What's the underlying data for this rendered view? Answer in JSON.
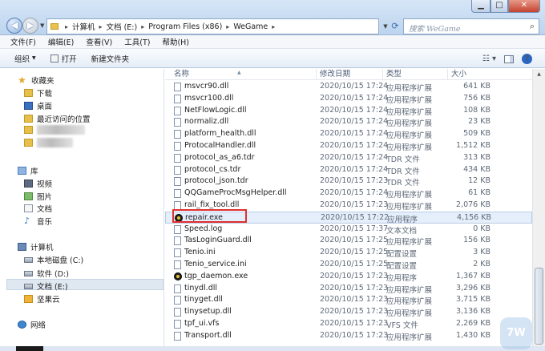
{
  "window": {
    "controls": {
      "minimize": "▁",
      "maximize": "□",
      "close": "✕"
    }
  },
  "nav_buttons": {
    "back": "◀",
    "forward": "▶"
  },
  "address": {
    "crumbs": [
      "计算机",
      "文档 (E:)",
      "Program Files (x86)",
      "WeGame"
    ],
    "separator": "▸"
  },
  "search": {
    "placeholder": "搜索 WeGame"
  },
  "menu": [
    "文件(F)",
    "编辑(E)",
    "查看(V)",
    "工具(T)",
    "帮助(H)"
  ],
  "toolbar": {
    "organize": "组织",
    "open": "打开",
    "new_folder": "新建文件夹"
  },
  "sidebar": {
    "favorites": "收藏夹",
    "downloads": "下载",
    "desktop": "桌面",
    "recent": "最近访问的位置",
    "libraries": "库",
    "videos": "视频",
    "pictures": "图片",
    "documents": "文档",
    "music": "音乐",
    "computer": "计算机",
    "drive_c": "本地磁盘 (C:)",
    "drive_d": "软件 (D:)",
    "drive_e": "文档 (E:)",
    "cloud": "坚果云",
    "network": "网络"
  },
  "columns": {
    "name": "名称",
    "date": "修改日期",
    "type": "类型",
    "size": "大小"
  },
  "files": [
    {
      "name": "msvcr90.dll",
      "date": "2020/10/15 17:24",
      "type": "应用程序扩展",
      "size": "641 KB",
      "icon": "dll"
    },
    {
      "name": "msvcr100.dll",
      "date": "2020/10/15 17:24",
      "type": "应用程序扩展",
      "size": "756 KB",
      "icon": "dll"
    },
    {
      "name": "NetFlowLogic.dll",
      "date": "2020/10/15 17:24",
      "type": "应用程序扩展",
      "size": "108 KB",
      "icon": "dll"
    },
    {
      "name": "normaliz.dll",
      "date": "2020/10/15 17:24",
      "type": "应用程序扩展",
      "size": "23 KB",
      "icon": "dll"
    },
    {
      "name": "platform_health.dll",
      "date": "2020/10/15 17:24",
      "type": "应用程序扩展",
      "size": "509 KB",
      "icon": "dll"
    },
    {
      "name": "ProtocalHandler.dll",
      "date": "2020/10/15 17:24",
      "type": "应用程序扩展",
      "size": "1,512 KB",
      "icon": "dll"
    },
    {
      "name": "protocol_as_a6.tdr",
      "date": "2020/10/15 17:24",
      "type": "TDR 文件",
      "size": "313 KB",
      "icon": "file"
    },
    {
      "name": "protocol_cs.tdr",
      "date": "2020/10/15 17:24",
      "type": "TDR 文件",
      "size": "434 KB",
      "icon": "file"
    },
    {
      "name": "protocol_json.tdr",
      "date": "2020/10/15 17:23",
      "type": "TDR 文件",
      "size": "12 KB",
      "icon": "file"
    },
    {
      "name": "QQGameProcMsgHelper.dll",
      "date": "2020/10/15 17:24",
      "type": "应用程序扩展",
      "size": "61 KB",
      "icon": "dll"
    },
    {
      "name": "rail_fix_tool.dll",
      "date": "2020/10/15 17:23",
      "type": "应用程序扩展",
      "size": "2,076 KB",
      "icon": "dll"
    },
    {
      "name": "repair.exe",
      "date": "2020/10/15 17:22",
      "type": "应用程序",
      "size": "4,156 KB",
      "icon": "exe"
    },
    {
      "name": "Speed.log",
      "date": "2020/10/15 17:37",
      "type": "文本文档",
      "size": "0 KB",
      "icon": "file"
    },
    {
      "name": "TasLoginGuard.dll",
      "date": "2020/10/15 17:25",
      "type": "应用程序扩展",
      "size": "156 KB",
      "icon": "dll"
    },
    {
      "name": "Tenio.ini",
      "date": "2020/10/15 17:25",
      "type": "配置设置",
      "size": "3 KB",
      "icon": "file"
    },
    {
      "name": "Tenio_service.ini",
      "date": "2020/10/15 17:25",
      "type": "配置设置",
      "size": "2 KB",
      "icon": "file"
    },
    {
      "name": "tgp_daemon.exe",
      "date": "2020/10/15 17:23",
      "type": "应用程序",
      "size": "1,367 KB",
      "icon": "exe"
    },
    {
      "name": "tinydl.dll",
      "date": "2020/10/15 17:23",
      "type": "应用程序扩展",
      "size": "3,296 KB",
      "icon": "dll"
    },
    {
      "name": "tinyget.dll",
      "date": "2020/10/15 17:23",
      "type": "应用程序扩展",
      "size": "3,715 KB",
      "icon": "dll"
    },
    {
      "name": "tinysetup.dll",
      "date": "2020/10/15 17:23",
      "type": "应用程序扩展",
      "size": "3,136 KB",
      "icon": "dll"
    },
    {
      "name": "tpf_ui.vfs",
      "date": "2020/10/15 17:23",
      "type": "VFS 文件",
      "size": "2,269 KB",
      "icon": "file"
    },
    {
      "name": "Transport.dll",
      "date": "2020/10/15 17:23",
      "type": "应用程序扩展",
      "size": "1,430 KB",
      "icon": "dll"
    }
  ],
  "selected_file": "repair.exe",
  "watermark": "7W"
}
